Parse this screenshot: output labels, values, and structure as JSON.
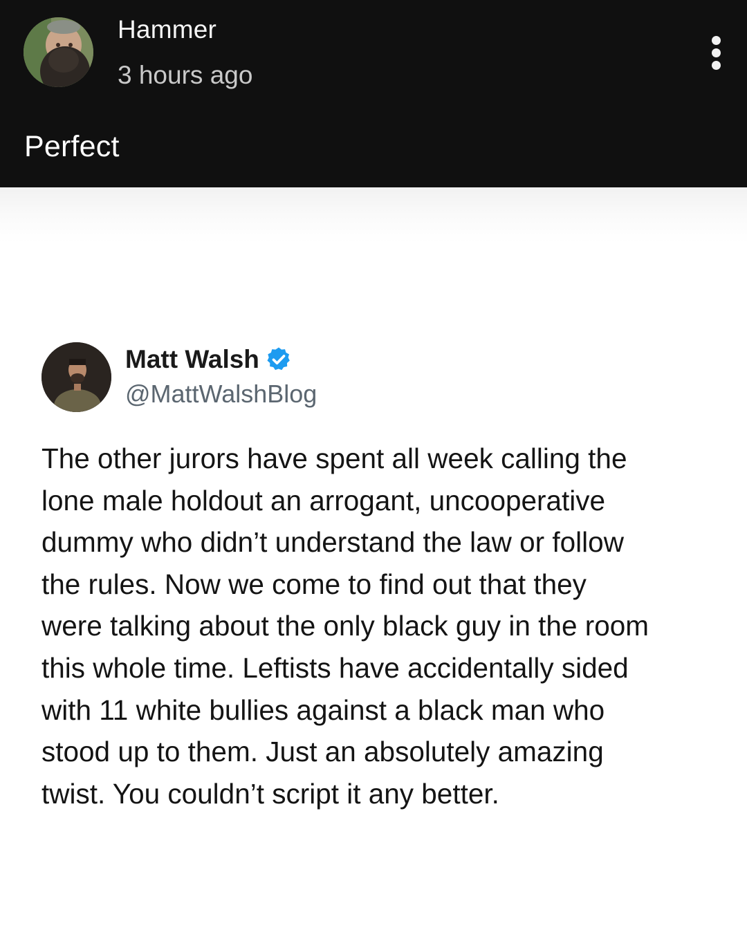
{
  "post": {
    "author": "Hammer",
    "timestamp": "3 hours ago",
    "caption": "Perfect",
    "menu_icon": "more-vertical-icon"
  },
  "tweet": {
    "display_name": "Matt Walsh",
    "verified_icon": "verified-badge-icon",
    "handle": "@MattWalshBlog",
    "lines": [
      "The other jurors have spent all week calling the",
      "lone male holdout an arrogant, uncooperative",
      "dummy who didn’t understand the law or follow",
      "the rules. Now we come to find out that they",
      "were talking about the only black guy in the room",
      "this whole time. Leftists have accidentally sided",
      "with 11 white bullies against a black man who",
      "stood up to them. Just an absolutely amazing",
      "twist. You couldn’t script it any better."
    ]
  },
  "colors": {
    "header_background": "#101010",
    "verified_blue": "#1d9bf0",
    "handle_gray": "#5b6670"
  }
}
